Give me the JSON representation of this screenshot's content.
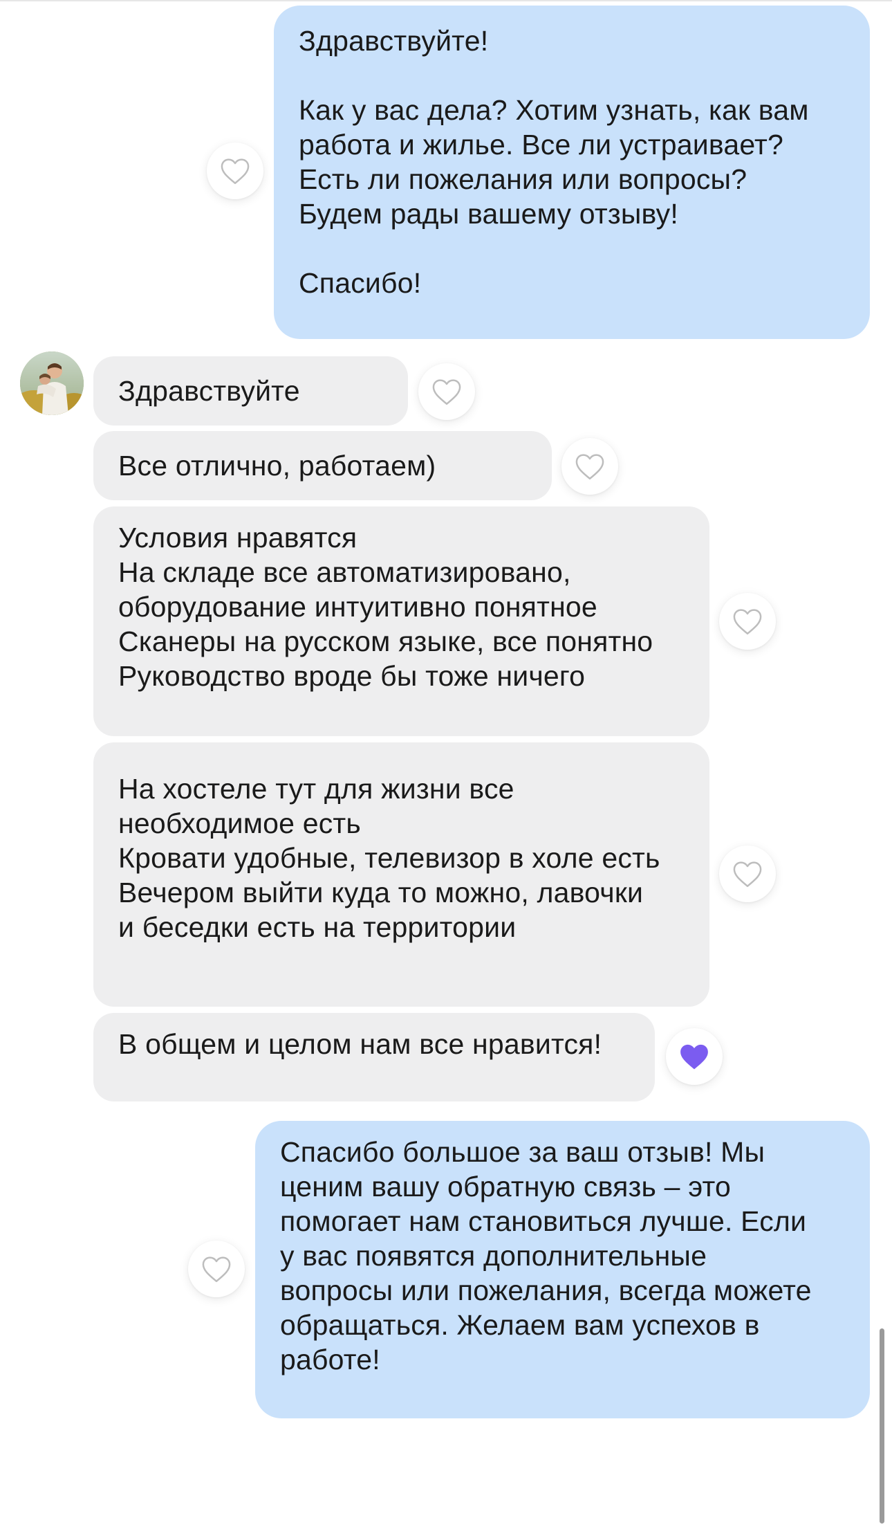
{
  "messages": [
    {
      "direction": "outgoing",
      "text": "Здравствуйте!\n\nКак у вас дела? Хотим узнать, как вам\nработа и жилье. Все ли устраивает?\nЕсть ли пожелания или вопросы?\nБудем рады вашему отзыву!\n\nСпасибо!",
      "liked": false
    },
    {
      "direction": "incoming",
      "text": "Здравствуйте",
      "liked": false
    },
    {
      "direction": "incoming",
      "text": "Все отлично, работаем)",
      "liked": false
    },
    {
      "direction": "incoming",
      "text": "Условия нравятся\nНа складе все автоматизировано,\nоборудование интуитивно понятное\nСканеры на русском языке, все понятно\nРуководство вроде бы тоже ничего",
      "liked": false
    },
    {
      "direction": "incoming",
      "text": "На хостеле тут для жизни все\nнеобходимое есть\nКровати удобные, телевизор в холе есть\nВечером выйти куда то можно, лавочки\nи беседки есть на территории",
      "liked": false
    },
    {
      "direction": "incoming",
      "text": "В общем и целом нам все нравится!",
      "liked": true
    },
    {
      "direction": "outgoing",
      "text": "Спасибо большое за ваш отзыв! Мы\nценим вашу обратную связь – это\nпомогает нам становиться лучше. Если\nу вас появятся дополнительные\nвопросы или пожелания, всегда можете\nобращаться. Желаем вам успехов в\nработе!",
      "liked": false
    }
  ],
  "icons": {
    "like": "heart-outline-icon",
    "liked": "heart-filled-icon",
    "avatar": "contact-avatar"
  },
  "colors": {
    "outgoing_bubble": "#c9e1fb",
    "incoming_bubble": "#eeeeef",
    "heart_outline": "#bdbdbd",
    "heart_filled": "#7b5cf0"
  }
}
